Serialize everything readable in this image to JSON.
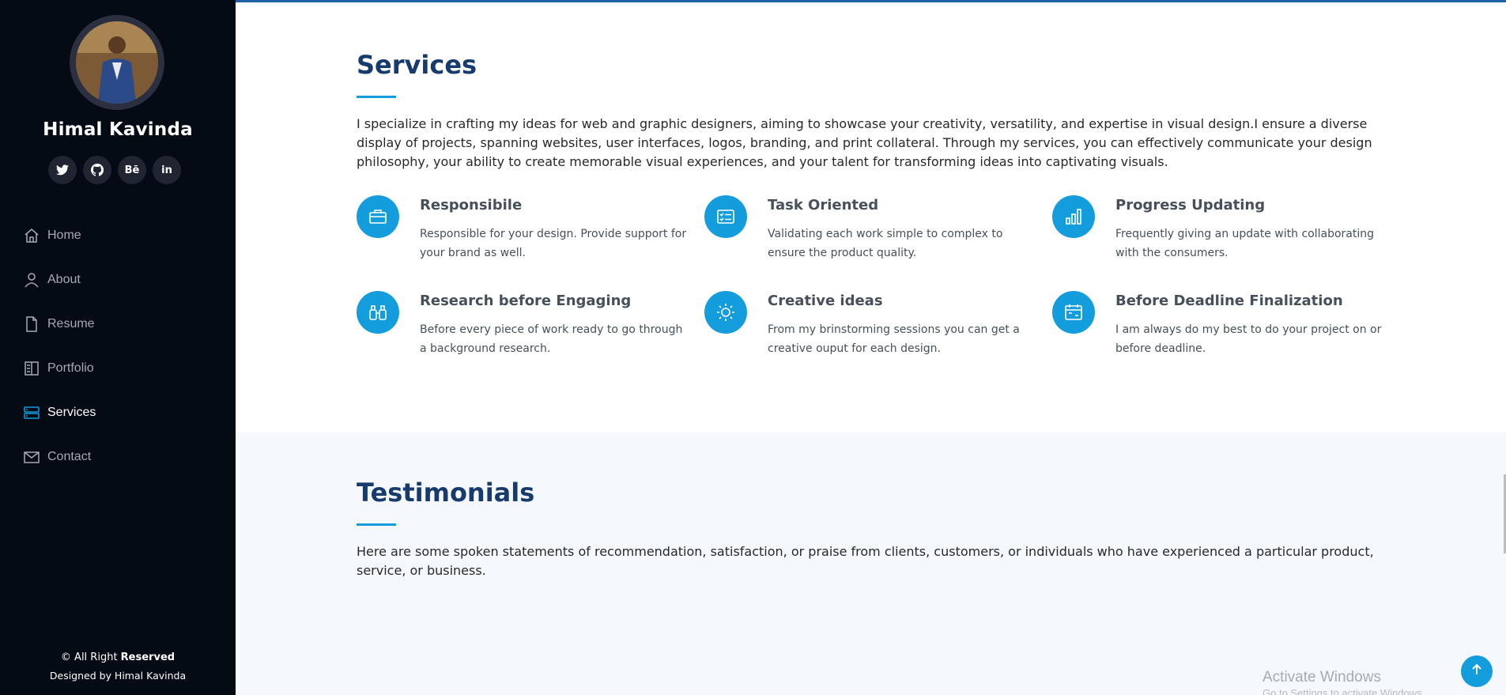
{
  "profile": {
    "name": "Himal Kavinda",
    "socials": [
      {
        "icon": "twitter-icon",
        "glyph": ""
      },
      {
        "icon": "github-icon",
        "glyph": ""
      },
      {
        "icon": "behance-icon",
        "glyph": "Bē"
      },
      {
        "icon": "linkedin-icon",
        "glyph": "in"
      }
    ]
  },
  "nav": {
    "items": [
      {
        "label": "Home",
        "icon": "home-icon"
      },
      {
        "label": "About",
        "icon": "person-icon"
      },
      {
        "label": "Resume",
        "icon": "file-icon"
      },
      {
        "label": "Portfolio",
        "icon": "book-half-icon"
      },
      {
        "label": "Services",
        "icon": "server-icon"
      },
      {
        "label": "Contact",
        "icon": "envelope-icon"
      }
    ],
    "active": "Services"
  },
  "footer": {
    "copyright_prefix": "© All Right ",
    "copyright_bold": "Reserved",
    "designed_by": "Designed by Himal Kavinda"
  },
  "services": {
    "title": "Services",
    "intro": "I specialize in crafting my ideas for web and graphic designers, aiming to showcase your creativity, versatility, and expertise in visual design.I ensure a diverse display of projects, spanning websites, user interfaces, logos, branding, and print collateral. Through my services, you can effectively communicate your design philosophy, your ability to create memorable visual experiences, and your talent for transforming ideas into captivating visuals.",
    "items": [
      {
        "title": "Responsibile",
        "desc": "Responsible for your design. Provide support for your brand as well.",
        "icon": "briefcase-icon"
      },
      {
        "title": "Task Oriented",
        "desc": "Validating each work simple to complex to ensure the product quality.",
        "icon": "card-checklist-icon"
      },
      {
        "title": "Progress Updating",
        "desc": "Frequently giving an update with collaborating with the consumers.",
        "icon": "bar-chart-icon"
      },
      {
        "title": "Research before Engaging",
        "desc": "Before every piece of work ready to go through a background research.",
        "icon": "binoculars-icon"
      },
      {
        "title": "Creative ideas",
        "desc": "From my brinstorming sessions you can get a creative ouput for each design.",
        "icon": "brightness-icon"
      },
      {
        "title": "Before Deadline Finalization",
        "desc": "I am always do my best to do your project on or before deadline.",
        "icon": "calendar-icon"
      }
    ]
  },
  "testimonials": {
    "title": "Testimonials",
    "intro": "Here are some spoken statements of recommendation, satisfaction, or praise from clients, customers, or individuals who have experienced a particular product, service, or business."
  },
  "os_watermark": {
    "line1": "Activate Windows",
    "line2": "Go to Settings to activate Windows."
  },
  "colors": {
    "accent": "#149ddd",
    "sidebar_bg": "#040b14",
    "heading": "#173b6c"
  }
}
